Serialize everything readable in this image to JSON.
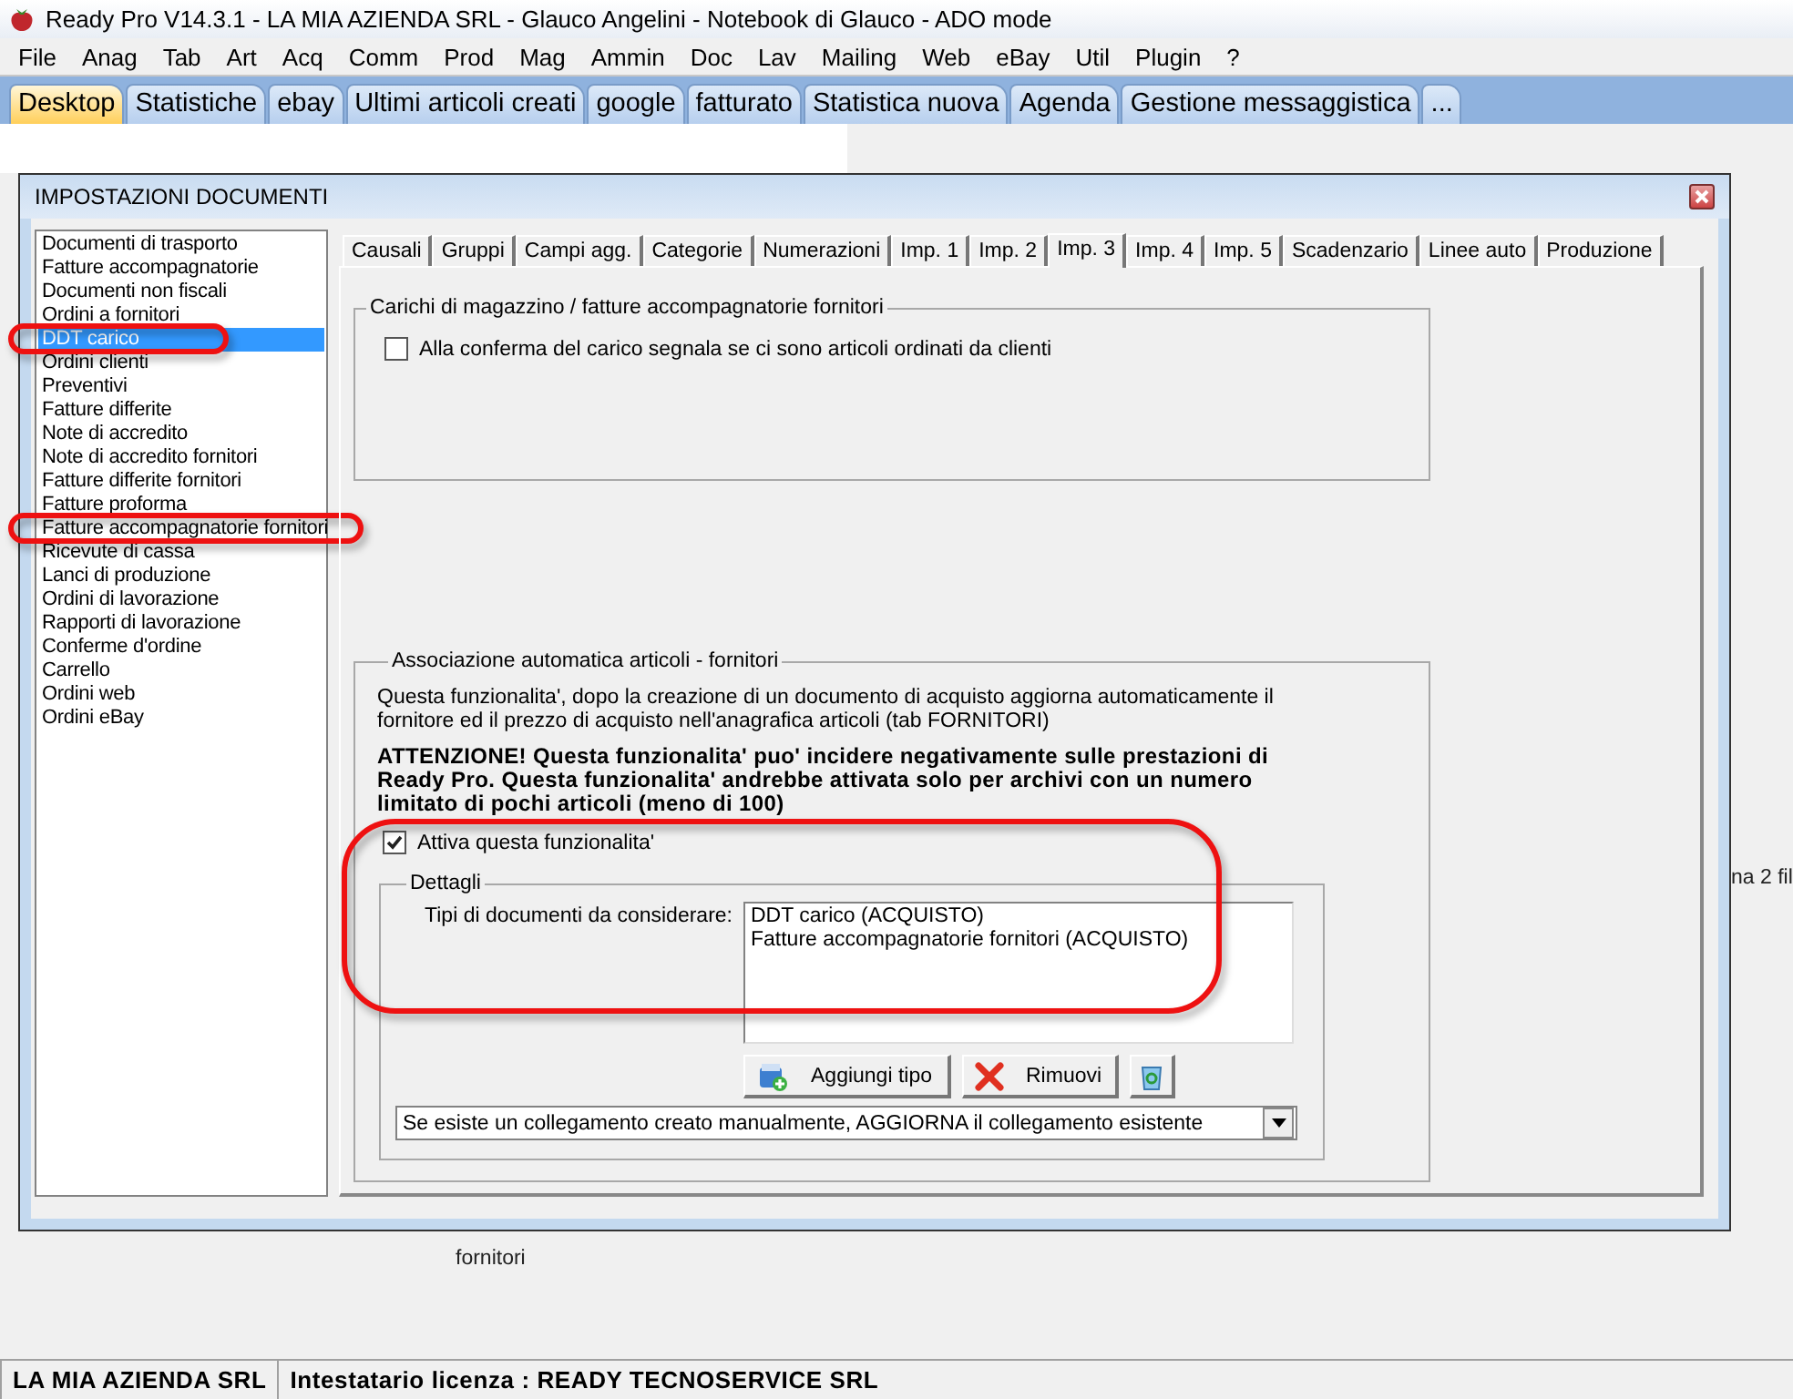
{
  "window": {
    "title": "Ready Pro V14.3.1 - LA MIA AZIENDA SRL - Glauco Angelini - Notebook di Glauco - ADO mode"
  },
  "menu": [
    "File",
    "Anag",
    "Tab",
    "Art",
    "Acq",
    "Comm",
    "Prod",
    "Mag",
    "Ammin",
    "Doc",
    "Lav",
    "Mailing",
    "Web",
    "eBay",
    "Util",
    "Plugin",
    "?"
  ],
  "app_tabs": [
    {
      "label": "Desktop",
      "selected": true
    },
    {
      "label": "Statistiche",
      "selected": false
    },
    {
      "label": "ebay",
      "selected": false
    },
    {
      "label": "Ultimi articoli creati",
      "selected": false
    },
    {
      "label": "google",
      "selected": false
    },
    {
      "label": "fatturato",
      "selected": false
    },
    {
      "label": "Statistica nuova",
      "selected": false
    },
    {
      "label": "Agenda",
      "selected": false
    },
    {
      "label": "Gestione messaggistica",
      "selected": false
    },
    {
      "label": "...",
      "selected": false
    }
  ],
  "desktop_labels": [
    "fornitori",
    "na 2 fil"
  ],
  "dialog": {
    "title": "IMPOSTAZIONI DOCUMENTI",
    "document_types": [
      {
        "label": "Documenti di trasporto",
        "selected": false,
        "highlighted": false
      },
      {
        "label": "Fatture accompagnatorie",
        "selected": false,
        "highlighted": false
      },
      {
        "label": "Documenti non fiscali",
        "selected": false,
        "highlighted": false
      },
      {
        "label": "Ordini a fornitori",
        "selected": false,
        "highlighted": false
      },
      {
        "label": "DDT carico",
        "selected": true,
        "highlighted": true
      },
      {
        "label": "Ordini clienti",
        "selected": false,
        "highlighted": false
      },
      {
        "label": "Preventivi",
        "selected": false,
        "highlighted": false
      },
      {
        "label": "Fatture differite",
        "selected": false,
        "highlighted": false
      },
      {
        "label": "Note di accredito",
        "selected": false,
        "highlighted": false
      },
      {
        "label": "Note di accredito fornitori",
        "selected": false,
        "highlighted": false
      },
      {
        "label": "Fatture differite fornitori",
        "selected": false,
        "highlighted": false
      },
      {
        "label": "Fatture proforma",
        "selected": false,
        "highlighted": false
      },
      {
        "label": "Fatture accompagnatorie fornitori",
        "selected": false,
        "highlighted": true
      },
      {
        "label": "Ricevute di cassa",
        "selected": false,
        "highlighted": false
      },
      {
        "label": "Lanci di produzione",
        "selected": false,
        "highlighted": false
      },
      {
        "label": "Ordini di lavorazione",
        "selected": false,
        "highlighted": false
      },
      {
        "label": "Rapporti di lavorazione",
        "selected": false,
        "highlighted": false
      },
      {
        "label": "Conferme d'ordine",
        "selected": false,
        "highlighted": false
      },
      {
        "label": "Carrello",
        "selected": false,
        "highlighted": false
      },
      {
        "label": "Ordini web",
        "selected": false,
        "highlighted": false
      },
      {
        "label": "Ordini eBay",
        "selected": false,
        "highlighted": false
      }
    ],
    "tabs": [
      {
        "label": "Causali",
        "selected": false
      },
      {
        "label": "Gruppi",
        "selected": false
      },
      {
        "label": "Campi agg.",
        "selected": false
      },
      {
        "label": "Categorie",
        "selected": false
      },
      {
        "label": "Numerazioni",
        "selected": false
      },
      {
        "label": "Imp. 1",
        "selected": false
      },
      {
        "label": "Imp. 2",
        "selected": false
      },
      {
        "label": "Imp. 3",
        "selected": true
      },
      {
        "label": "Imp. 4",
        "selected": false
      },
      {
        "label": "Imp. 5",
        "selected": false
      },
      {
        "label": "Scadenzario",
        "selected": false
      },
      {
        "label": "Linee auto",
        "selected": false
      },
      {
        "label": "Produzione",
        "selected": false
      }
    ],
    "loads_group": {
      "title": "Carichi di magazzino / fatture accompagnatorie fornitori",
      "checkbox": {
        "label": "Alla conferma del carico segnala se ci sono articoli ordinati da clienti",
        "checked": false
      }
    },
    "association_group": {
      "title": "Associazione automatica articoli - fornitori",
      "description": "Questa funzionalita', dopo la creazione di un documento di acquisto aggiorna automaticamente il fornitore ed il prezzo di acquisto nell'anagrafica articoli (tab FORNITORI)",
      "warning": "ATTENZIONE! Questa funzionalita' puo' incidere negativamente sulle prestazioni di Ready Pro. Questa funzionalita' andrebbe attivata solo per archivi con un numero limitato di pochi articoli (meno di 100)",
      "checkbox": {
        "label": "Attiva questa funzionalita'",
        "checked": true,
        "highlighted": true
      },
      "details": {
        "title": "Dettagli",
        "list_label": "Tipi di documenti da considerare:",
        "list_items": [
          "DDT carico (ACQUISTO)",
          "Fatture accompagnatorie fornitori (ACQUISTO)"
        ],
        "add_button": "Aggiungi tipo",
        "remove_button": "Rimuovi",
        "mode": "Se esiste un collegamento creato manualmente, AGGIORNA il collegamento esistente"
      }
    }
  },
  "status_bar": [
    "LA MIA AZIENDA SRL",
    "Intestatario licenza : READY TECNOSERVICE SRL"
  ]
}
